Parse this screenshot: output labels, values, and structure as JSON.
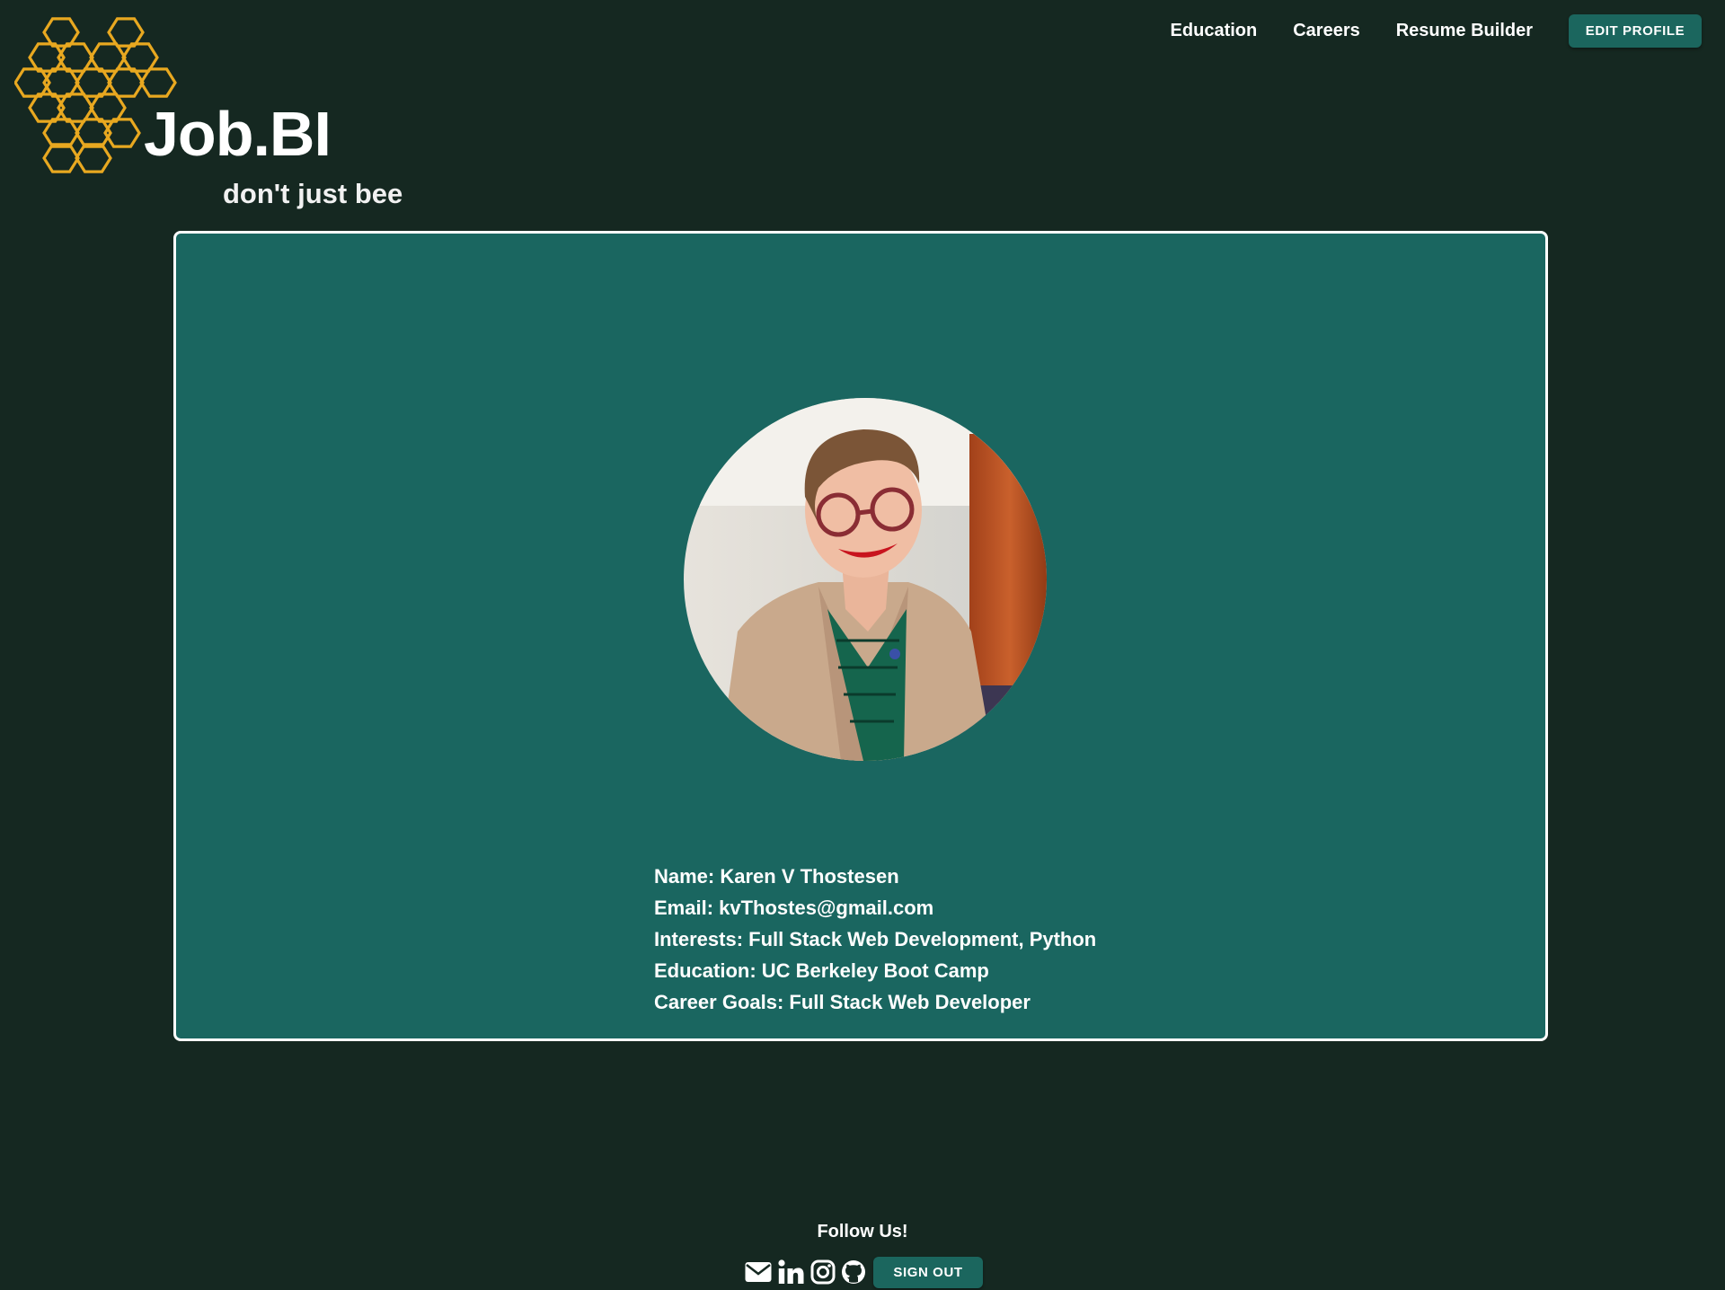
{
  "brand": {
    "name": "Job.BI",
    "tagline": "don't just bee",
    "accent_color": "#e8a820"
  },
  "nav": {
    "links": [
      "Education",
      "Careers",
      "Resume Builder"
    ],
    "edit_profile_label": "EDIT PROFILE"
  },
  "profile": {
    "photo": "profile-photo",
    "name_line": "Name: Karen V Thostesen",
    "email_line": "Email: kvThostes@gmail.com",
    "interests_line": "Interests: Full Stack Web Development, Python",
    "education_line": "Education: UC Berkeley Boot Camp",
    "career_goals_line": "Career Goals: Full Stack Web Developer"
  },
  "footer": {
    "follow_label": "Follow Us!",
    "icons": [
      "envelope-icon",
      "linkedin-icon",
      "instagram-icon",
      "github-icon"
    ],
    "sign_out_label": "SIGN OUT"
  },
  "colors": {
    "background": "#152821",
    "card": "#1a6660",
    "button": "#1b665e",
    "card_border": "#ffffff"
  }
}
